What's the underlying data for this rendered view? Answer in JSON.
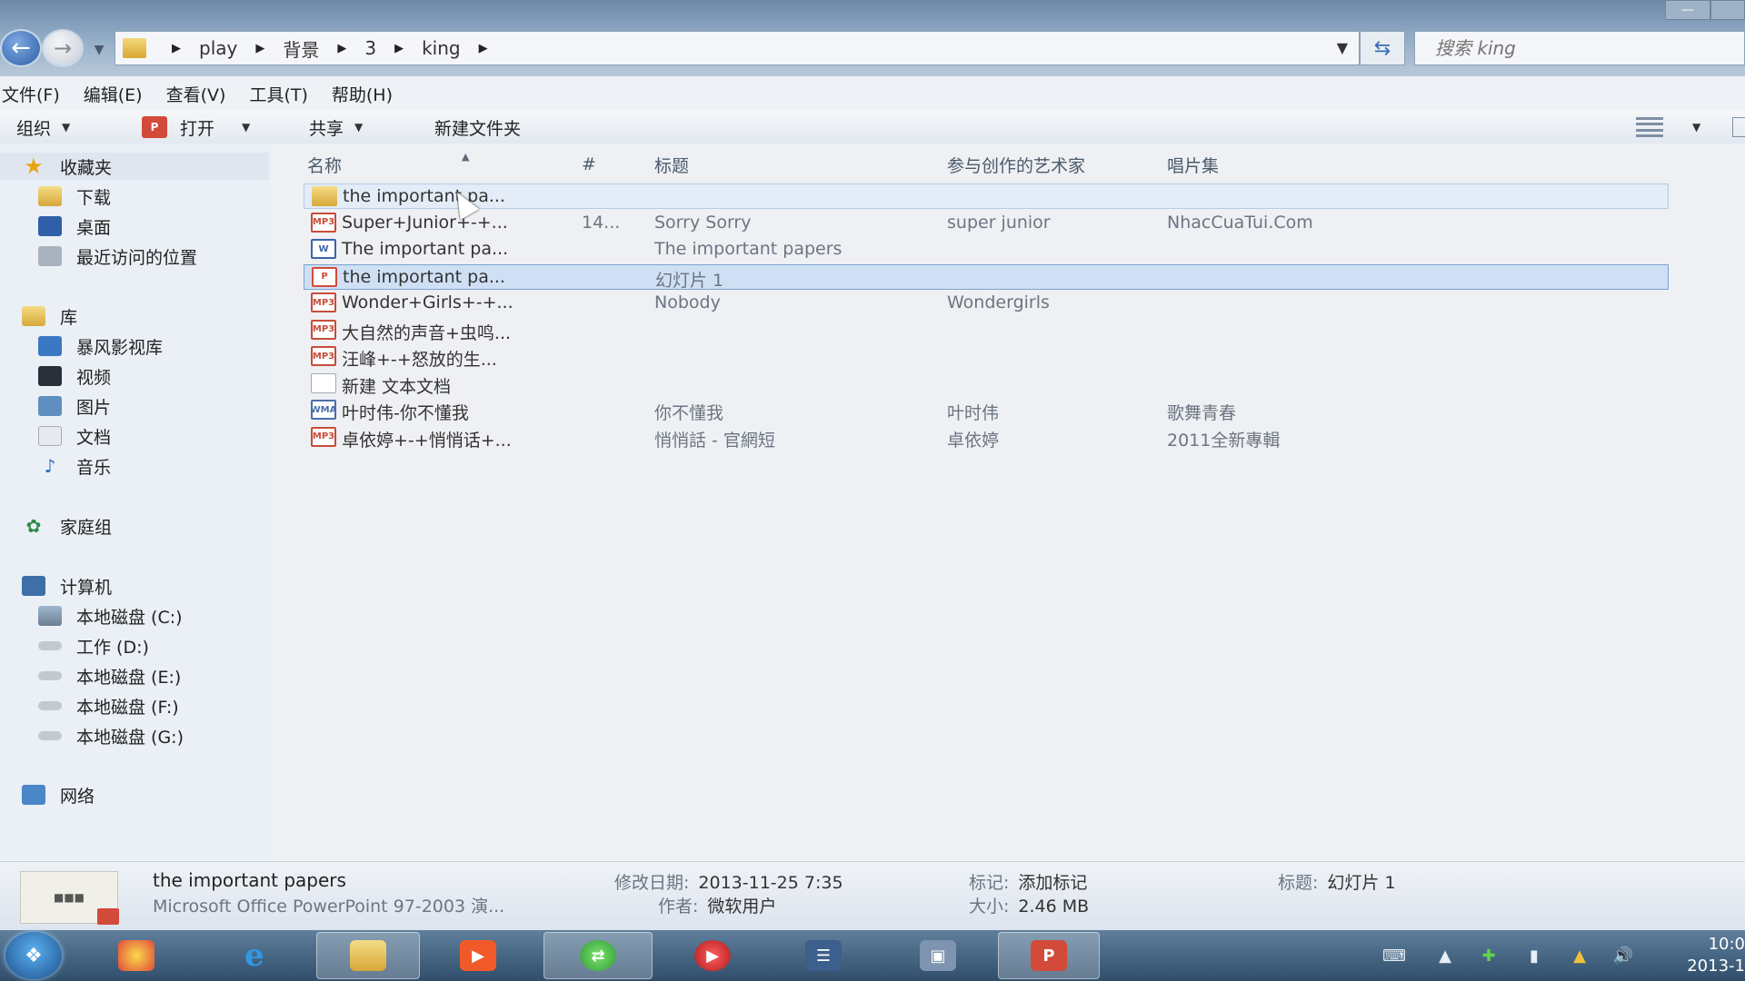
{
  "window": {
    "nav": {
      "back_icon": "back-arrow-icon",
      "forward_icon": "forward-arrow-icon"
    },
    "breadcrumb": [
      "play",
      "背景",
      "3",
      "king"
    ],
    "search": {
      "placeholder": "搜索 king"
    }
  },
  "menu": [
    "文件(F)",
    "编辑(E)",
    "查看(V)",
    "工具(T)",
    "帮助(H)"
  ],
  "toolbar": {
    "organize": "组织",
    "open": "打开",
    "share": "共享",
    "new_folder": "新建文件夹"
  },
  "sidebar": {
    "favorites": {
      "label": "收藏夹",
      "items": [
        "下载",
        "桌面",
        "最近访问的位置"
      ]
    },
    "libraries": {
      "label": "库",
      "items": [
        "暴风影视库",
        "视频",
        "图片",
        "文档",
        "音乐"
      ]
    },
    "homegroup": "家庭组",
    "computer": {
      "label": "计算机",
      "items": [
        "本地磁盘 (C:)",
        "工作 (D:)",
        "本地磁盘 (E:)",
        "本地磁盘 (F:)",
        "本地磁盘 (G:)"
      ]
    },
    "network": "网络"
  },
  "columns": {
    "name": "名称",
    "number": "#",
    "title": "标题",
    "artist": "参与创作的艺术家",
    "album": "唱片集"
  },
  "files": [
    {
      "name": "the important pa...",
      "number": "",
      "title": "",
      "artist": "",
      "album": "",
      "type": "folder",
      "state": "hover"
    },
    {
      "name": "Super+Junior+-+...",
      "number": "14...",
      "title": "Sorry Sorry",
      "artist": "super junior",
      "album": "NhacCuaTui.Com",
      "type": "media",
      "state": ""
    },
    {
      "name": "The important pa...",
      "number": "",
      "title": "The important papers",
      "artist": "",
      "album": "",
      "type": "word",
      "state": ""
    },
    {
      "name": "the important pa...",
      "number": "",
      "title": "幻灯片 1",
      "artist": "",
      "album": "",
      "type": "ppt",
      "state": "selected"
    },
    {
      "name": "Wonder+Girls+-+...",
      "number": "",
      "title": "Nobody",
      "artist": "Wondergirls",
      "album": "",
      "type": "media",
      "state": ""
    },
    {
      "name": "大自然的声音+虫鸣...",
      "number": "",
      "title": "",
      "artist": "",
      "album": "",
      "type": "media",
      "state": ""
    },
    {
      "name": "汪峰+-+怒放的生...",
      "number": "",
      "title": "",
      "artist": "",
      "album": "",
      "type": "media",
      "state": ""
    },
    {
      "name": "新建 文本文档",
      "number": "",
      "title": "",
      "artist": "",
      "album": "",
      "type": "txt",
      "state": ""
    },
    {
      "name": "叶时伟-你不懂我",
      "number": "",
      "title": "你不懂我",
      "artist": "叶时伟",
      "album": "歌舞青春",
      "type": "wma",
      "state": ""
    },
    {
      "name": "卓依婷+-+悄悄话+...",
      "number": "",
      "title": "悄悄話 - 官網短",
      "artist": "卓依婷",
      "album": "2011全新專輯",
      "type": "media",
      "state": ""
    }
  ],
  "details": {
    "filename": "the important papers",
    "filetype": "Microsoft Office PowerPoint 97-2003 演...",
    "modified_label": "修改日期:",
    "modified": "2013-11-25 7:35",
    "author_label": "作者:",
    "author": "微软用户",
    "tags_label": "标记:",
    "tags": "添加标记",
    "size_label": "大小:",
    "size": "2.46 MB",
    "title_label": "标题:",
    "title": "幻灯片 1"
  },
  "taskbar": {
    "clock_time": "10:0",
    "clock_date": "2013-1",
    "colors": {
      "accent": "#3b6db0",
      "selection": "#cfe0f5"
    }
  }
}
